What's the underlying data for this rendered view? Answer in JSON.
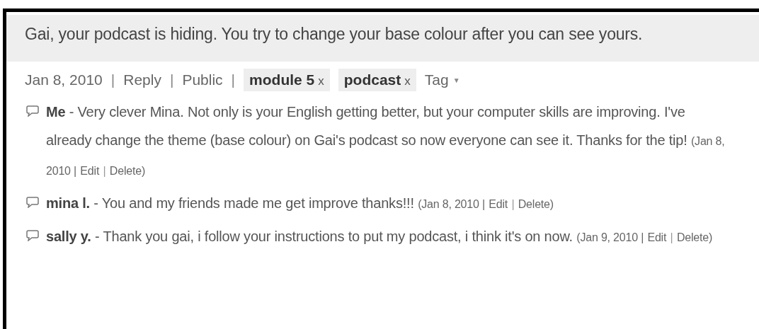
{
  "post": {
    "text": "Gai, your podcast is hiding. You try to change your base colour after you can see yours."
  },
  "meta": {
    "date": "Jan 8, 2010",
    "separator": "|",
    "links": [
      "Reply",
      "Public"
    ],
    "tags": [
      {
        "label": "module 5",
        "remove": "x"
      },
      {
        "label": "podcast",
        "remove": "x"
      }
    ],
    "tag_menu": "Tag",
    "tag_caret": "▼"
  },
  "comments": [
    {
      "text": "**Me** - Very clever Mina. Not only is your English getting better, but your computer skills are improving. I've already change the theme (base colour) on Gai's podcast so now everyone can see it. Thanks for the tip!",
      "date": "(Jan 8, 2010 |",
      "actions": [
        "Edit",
        "Delete"
      ],
      "separator": "|",
      "close": ")"
    },
    {
      "text": "**mina l.** - You and my friends made me get improve thanks!!!",
      "date": "(Jan 8, 2010 |",
      "actions": [
        "Edit",
        "Delete"
      ],
      "separator": "|",
      "close": ")"
    },
    {
      "text": "**sally y.** - Thank you gai, i follow your instructions to put my podcast, i think it's on now.",
      "date": "(Jan 9, 2010 |",
      "actions": [
        "Edit",
        "Delete"
      ],
      "separator": "|",
      "close": ")"
    }
  ]
}
